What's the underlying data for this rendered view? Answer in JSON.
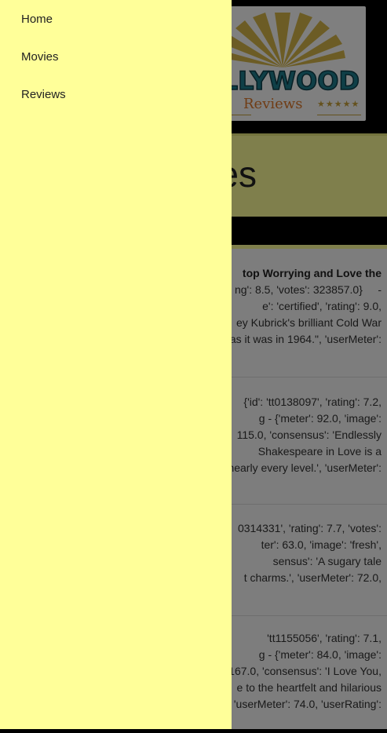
{
  "logo": {
    "word": "OLLYWOOD",
    "tagline": "Reviews",
    "stars_left": "★★",
    "stars_right": "★★★★★"
  },
  "page_title_fragment": "es",
  "reviews": [
    {
      "lines": [
        "top Worrying and Love the",
        "ng': 8.5, 'votes': 323857.0}     -",
        "e': 'certified', 'rating': 9.0,",
        "ey Kubrick's brilliant Cold War",
        "as it was in 1964.\", 'userMeter':"
      ]
    },
    {
      "lines": [
        "{'id': 'tt0138097', 'rating': 7.2,",
        "g - {'meter': 92.0, 'image':",
        "115.0, 'consensus': 'Endlessly",
        "Shakespeare in Love is a",
        "nearly every level.', 'userMeter':"
      ]
    },
    {
      "lines": [
        "0314331', 'rating': 7.7, 'votes':",
        "ter': 63.0, 'image': 'fresh',",
        "sensus': 'A sugary tale",
        "t charms.', 'userMeter': 72.0,"
      ]
    },
    {
      "lines": [
        "'tt1155056', 'rating': 7.1,",
        "g - {'meter': 84.0, 'image':",
        "167.0, 'consensus': 'I Love You,",
        "e to the heartfelt and hilarious",
        "'userMeter': 74.0, 'userRating':"
      ]
    }
  ],
  "nav": {
    "items": [
      {
        "label": "Home"
      },
      {
        "label": "Movies"
      },
      {
        "label": "Reviews"
      }
    ]
  }
}
